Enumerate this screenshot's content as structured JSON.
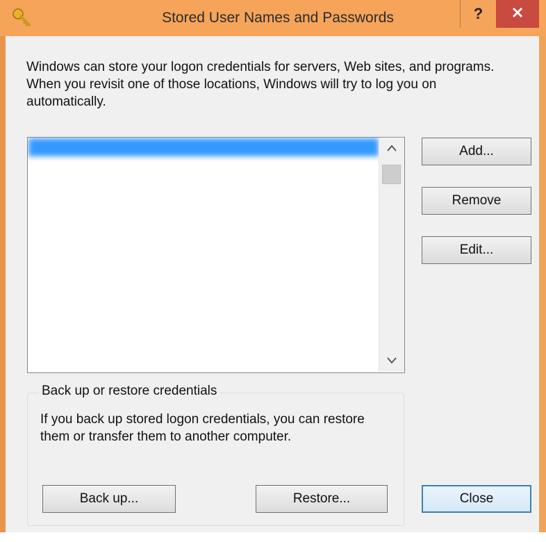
{
  "window": {
    "title": "Stored User Names and Passwords",
    "help_label": "?",
    "close_label": "X",
    "accent_color": "#f5a45a",
    "close_color": "#c94a3e"
  },
  "description": "Windows can store your logon credentials for servers, Web sites, and programs. When you revisit one of those locations, Windows will try to log you on automatically.",
  "credentials": {
    "selected_index": 0,
    "items": [
      "",
      "",
      "",
      "",
      "",
      "",
      "",
      "",
      "",
      "",
      "",
      "",
      ""
    ]
  },
  "buttons": {
    "add": "Add...",
    "remove": "Remove",
    "edit": "Edit...",
    "backup": "Back up...",
    "restore": "Restore...",
    "close": "Close"
  },
  "backup_group": {
    "title": "Back up or restore credentials",
    "description": "If you back up stored logon credentials, you can restore them or transfer them to another computer."
  },
  "icons": {
    "app": "key-icon",
    "scroll_up": "chevron-up-icon",
    "scroll_down": "chevron-down-icon"
  }
}
